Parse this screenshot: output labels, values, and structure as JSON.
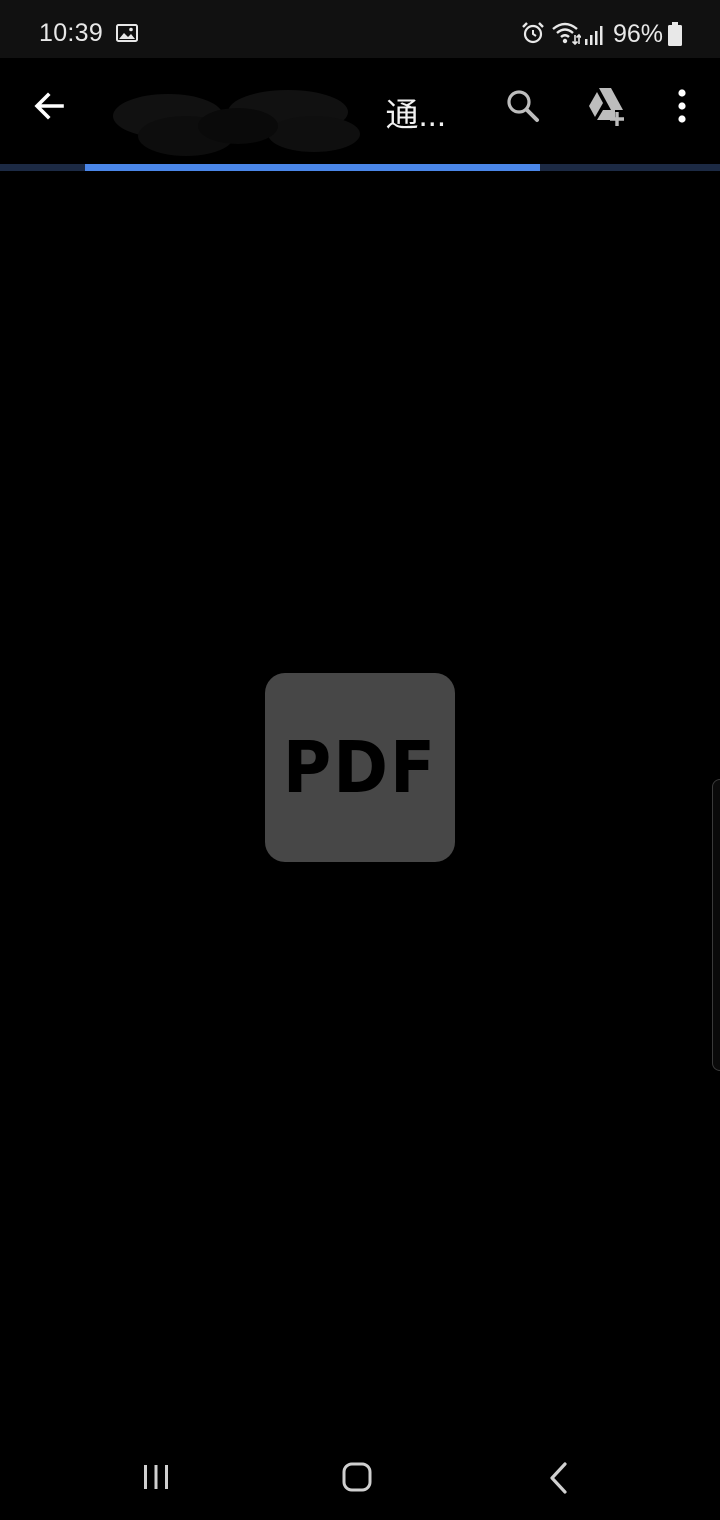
{
  "status_bar": {
    "time": "10:39",
    "battery": "96%",
    "icons": [
      "gallery-icon",
      "alarm-icon",
      "wifi-icon",
      "signal-icon",
      "battery-icon"
    ]
  },
  "app_bar": {
    "title": "通...",
    "actions": [
      "search-icon",
      "drive-add-icon",
      "more-vert-icon"
    ]
  },
  "progress": {
    "color": "#4a86e8",
    "start": 0.118,
    "end": 0.75
  },
  "document": {
    "placeholder_label": "PDF"
  },
  "nav_bar": {
    "icons": [
      "recents-icon",
      "home-icon",
      "back-icon"
    ]
  }
}
